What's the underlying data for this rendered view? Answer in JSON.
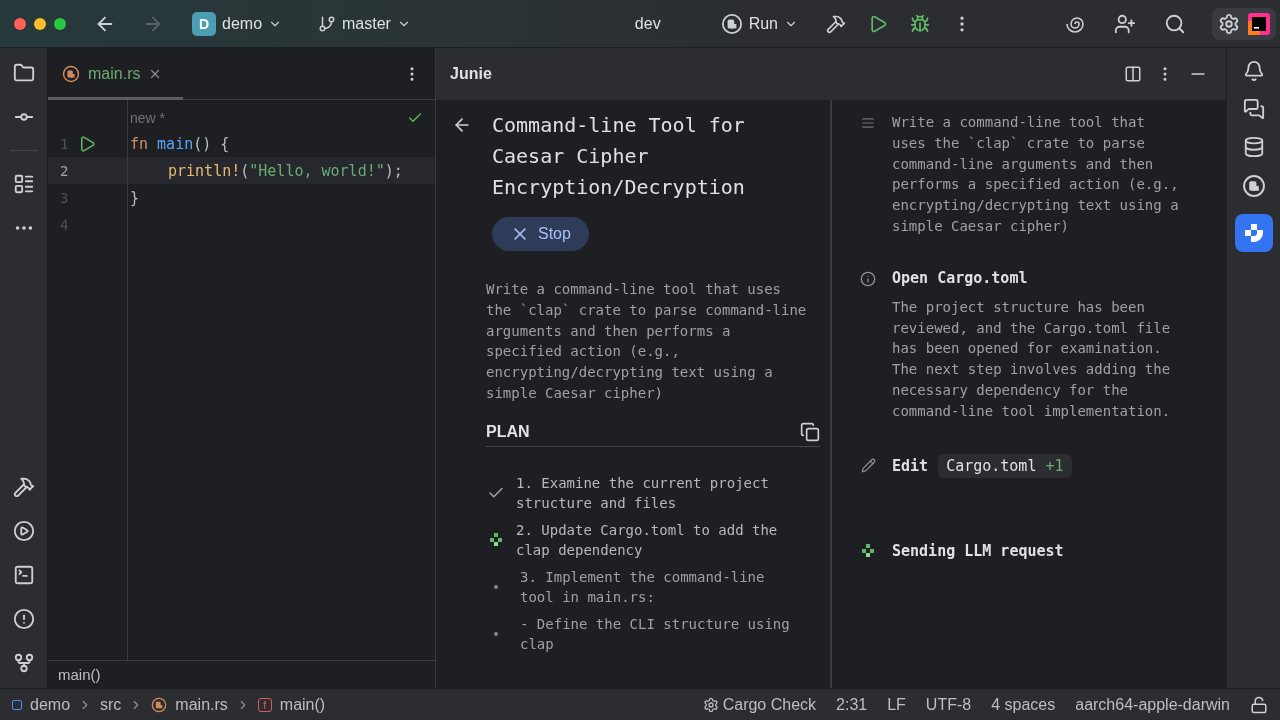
{
  "toolbar": {
    "project": {
      "initial": "D",
      "name": "demo"
    },
    "branch": "master",
    "config": "dev",
    "run": "Run"
  },
  "editor": {
    "tab": {
      "name": "main.rs",
      "selected": true
    },
    "label": "new *",
    "lines": [
      {
        "number": "1",
        "run": true,
        "current": false,
        "indented": false,
        "tokens": [
          {
            "kind": "keyword",
            "text": "fn"
          },
          {
            "kind": "function",
            "text": " main"
          },
          {
            "kind": "plain",
            "text": "() {"
          }
        ]
      },
      {
        "number": "2",
        "run": false,
        "current": true,
        "indented": true,
        "tokens": [
          {
            "kind": "macro",
            "text": "println!"
          },
          {
            "kind": "plain",
            "text": "("
          },
          {
            "kind": "string",
            "text": "\"Hello, world!\""
          },
          {
            "kind": "plain",
            "text": ");"
          }
        ]
      },
      {
        "number": "3",
        "run": false,
        "current": false,
        "indented": false,
        "tokens": [
          {
            "kind": "plain",
            "text": "}"
          }
        ]
      },
      {
        "number": "4",
        "run": false,
        "current": false
      }
    ],
    "breadcrumb": "main()"
  },
  "junie": {
    "title": "Junie",
    "task_title": "Command-line Tool for Caesar Cipher Encryption/Decryption",
    "stop": "Stop",
    "task": "Write a command-line tool that uses the `clap` crate to parse command-line arguments and then performs a specified action (e.g., encrypting/decrypting text using a simple Caesar cipher)",
    "plan_heading": "PLAN",
    "plan": [
      {
        "kind": "done",
        "text": "1. Examine the current project structure and files"
      },
      {
        "kind": "running",
        "text": "2. Update Cargo.toml to add the clap dependency"
      },
      {
        "kind": "pending",
        "text": "3. Implement the command-line tool in main.rs:"
      },
      {
        "kind": "pending",
        "text": "- Define the CLI structure using clap"
      }
    ],
    "steps": [
      {
        "kind": "task",
        "text": "Write a command-line tool that uses the `clap` crate to parse command-line arguments and then performs a specified action (e.g., encrypting/decrypting text using a simple Caesar cipher)"
      },
      {
        "kind": "info",
        "title": "Open Cargo.toml",
        "text": "The project structure has been reviewed, and the Cargo.toml file has been opened for examination. The next step involves adding the necessary dependency for the command-line tool implementation."
      },
      {
        "kind": "edit",
        "title": "Edit",
        "file": "Cargo.toml",
        "extra": "+1"
      },
      {
        "kind": "progress",
        "title": "Sending LLM request"
      }
    ]
  },
  "status_bar": {
    "path": [
      {
        "kind": "project",
        "text": "demo"
      },
      {
        "kind": "folder",
        "text": "src"
      },
      {
        "kind": "file",
        "text": "main.rs"
      },
      {
        "kind": "function",
        "icon": "f",
        "text": "main()"
      }
    ],
    "items": [
      {
        "kind": "check",
        "text": "Cargo Check"
      },
      {
        "kind": "plain",
        "text": "2:31"
      },
      {
        "kind": "plain",
        "text": "LF"
      },
      {
        "kind": "plain",
        "text": "UTF-8"
      },
      {
        "kind": "plain",
        "text": "4 spaces"
      },
      {
        "kind": "plain",
        "text": "aarch64-apple-darwin"
      }
    ]
  }
}
